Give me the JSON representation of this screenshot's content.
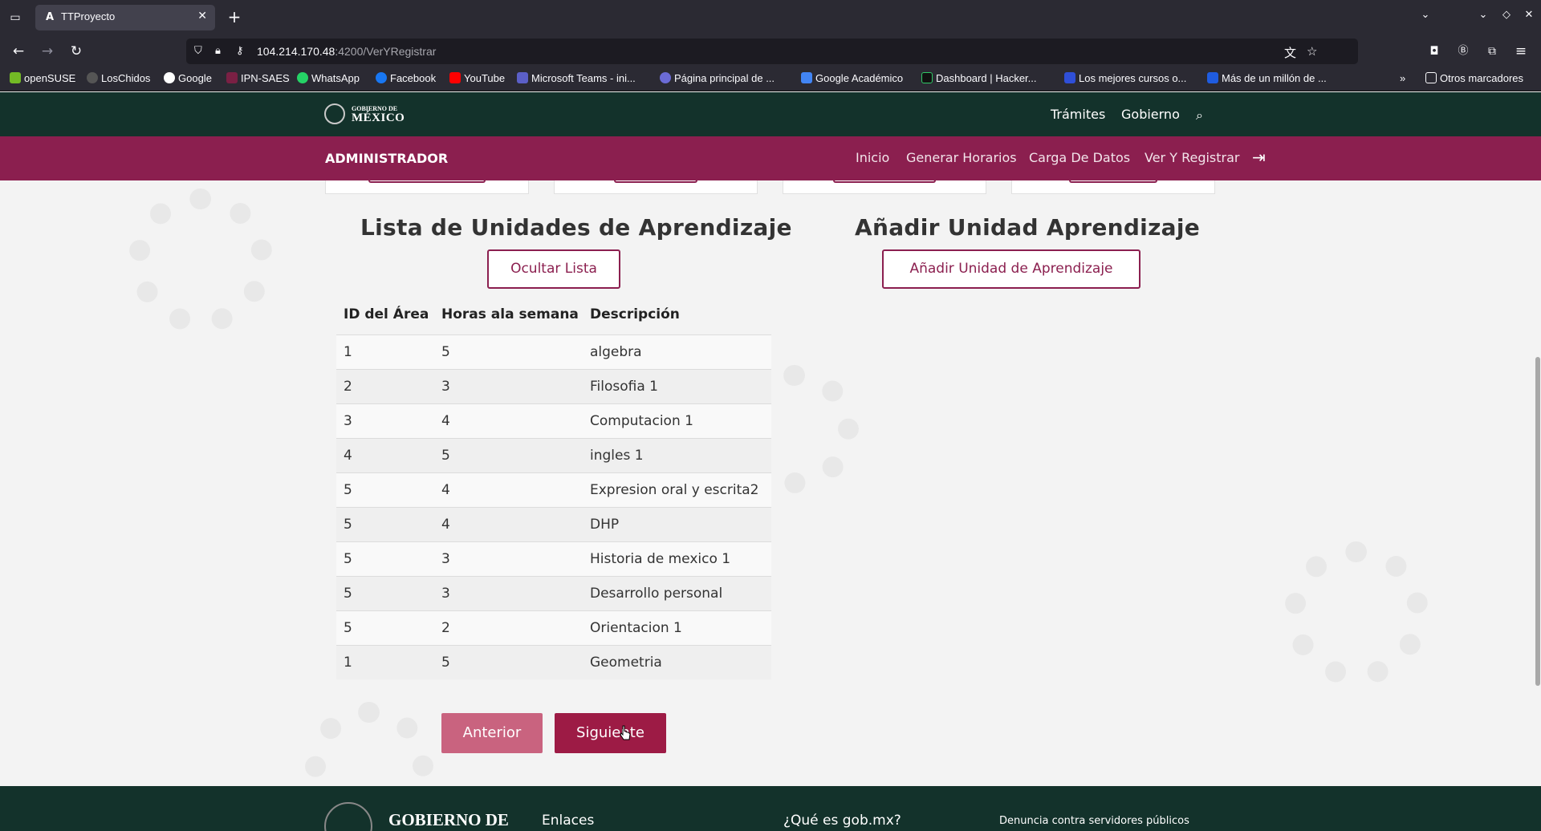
{
  "browser": {
    "tab_title": "TTProyecto",
    "url_host": "104.214.170.48",
    "url_path": ":4200/VerYRegistrar",
    "bookmarks": [
      "openSUSE",
      "LosChidos",
      "Google",
      "IPN-SAES",
      "WhatsApp",
      "Facebook",
      "YouTube",
      "Microsoft Teams - ini...",
      "Página principal de ...",
      "Google Académico",
      "Dashboard | Hacker...",
      "Los mejores cursos o...",
      "Más de un millón de ..."
    ],
    "other_bookmarks": "Otros marcadores",
    "colors": {
      "chrome": "#2b2a33",
      "urlbar": "#1c1b22"
    }
  },
  "gov_header": {
    "logo_small": "GOBIERNO DE",
    "logo_big": "MÉXICO",
    "links": [
      "Trámites",
      "Gobierno"
    ]
  },
  "admin_bar": {
    "title": "ADMINISTRADOR",
    "links": [
      "Inicio",
      "Generar Horarios",
      "Carga De Datos",
      "Ver Y Registrar"
    ],
    "color": "#8b1f4f"
  },
  "list_section": {
    "title": "Lista de Unidades de Aprendizaje",
    "toggle_label": "Ocultar Lista",
    "columns": [
      "ID del Área",
      "Horas ala semana",
      "Descripción"
    ],
    "rows": [
      [
        "1",
        "5",
        "algebra"
      ],
      [
        "2",
        "3",
        "Filosofia 1"
      ],
      [
        "3",
        "4",
        "Computacion 1"
      ],
      [
        "4",
        "5",
        "ingles 1"
      ],
      [
        "5",
        "4",
        "Expresion oral y escrita2"
      ],
      [
        "5",
        "4",
        "DHP"
      ],
      [
        "5",
        "3",
        "Historia de mexico 1"
      ],
      [
        "5",
        "3",
        "Desarrollo personal"
      ],
      [
        "5",
        "2",
        "Orientacion 1"
      ],
      [
        "1",
        "5",
        "Geometria"
      ]
    ]
  },
  "add_section": {
    "title": "Añadir Unidad Aprendizaje",
    "add_label": "Añadir Unidad de Aprendizaje"
  },
  "pager": {
    "prev_label": "Anterior",
    "next_label": "Siguiente",
    "prev_color": "#c9637f",
    "next_color": "#9d1b45"
  },
  "footer": {
    "logo": "GOBIERNO DE",
    "links": [
      "Enlaces",
      "¿Qué es gob.mx?"
    ],
    "small_link": "Denuncia contra servidores públicos"
  }
}
